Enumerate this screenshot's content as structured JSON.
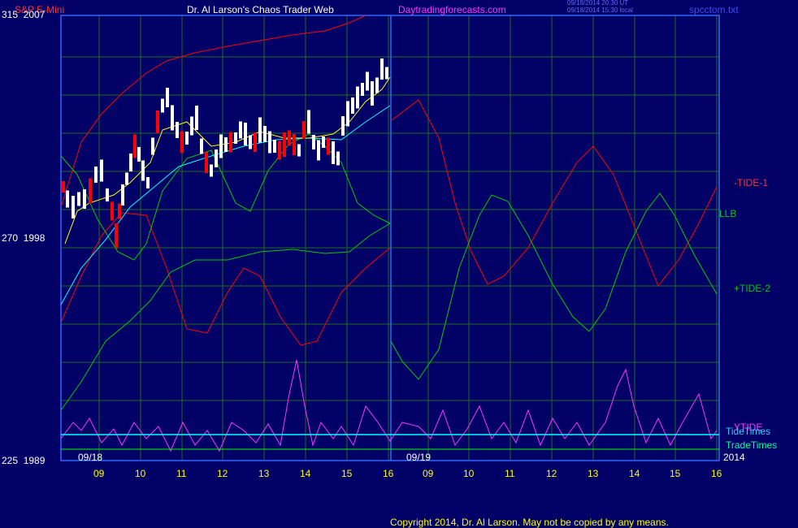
{
  "header": {
    "symbol": "S&P E-Mini",
    "author": "Dr. Al Larson's Chaos Trader Web",
    "site": "Daytradingforecasts.com",
    "timestamp_ut": "09/18/2014 20:30 UT",
    "timestamp_local": "09/18/2014 15:30 local",
    "filename": "spcctom.txt"
  },
  "y_axis_labels": [
    {
      "code": "315",
      "price": "2007"
    },
    {
      "code": "270",
      "price": "1998"
    },
    {
      "code": "225",
      "price": "1989"
    }
  ],
  "right_labels": {
    "tide1": "-TIDE-1",
    "llb": "LLB",
    "tide2": "+TIDE-2",
    "ytide": "YTIDE",
    "tidetimes": "TideTimes",
    "tradetimes": "TradeTimes"
  },
  "dates": {
    "d1": "09/18",
    "d2": "09/19",
    "year": "2014"
  },
  "colors": {
    "background": "#000066",
    "grid": "#1e6b1e",
    "price_up": "#ffffff",
    "price_down": "#ff0000",
    "tide1": "#ff0000",
    "tide2": "#00cc00",
    "ytide": "#ff33ff",
    "tidetimes": "#00ffff",
    "tradetimes": "#00ff00",
    "ma": "#ffff00",
    "ma2": "#00ffff"
  },
  "chart_data": {
    "type": "line",
    "x_tick_labels": [
      "09",
      "10",
      "11",
      "12",
      "13",
      "14",
      "15",
      "16",
      "09",
      "10",
      "11",
      "12",
      "13",
      "14",
      "15",
      "16"
    ],
    "y_range_price": [
      1989,
      2007
    ],
    "y_range_code": [
      225,
      315
    ],
    "series": [
      {
        "name": "-TIDE-1"
      },
      {
        "name": "+TIDE-2"
      },
      {
        "name": "LLB"
      },
      {
        "name": "YTIDE"
      },
      {
        "name": "TideTimes"
      },
      {
        "name": "TradeTimes"
      }
    ]
  },
  "footer": {
    "copyright": "Copyright 2014, Dr. Al Larson. May not be copied by any means."
  }
}
